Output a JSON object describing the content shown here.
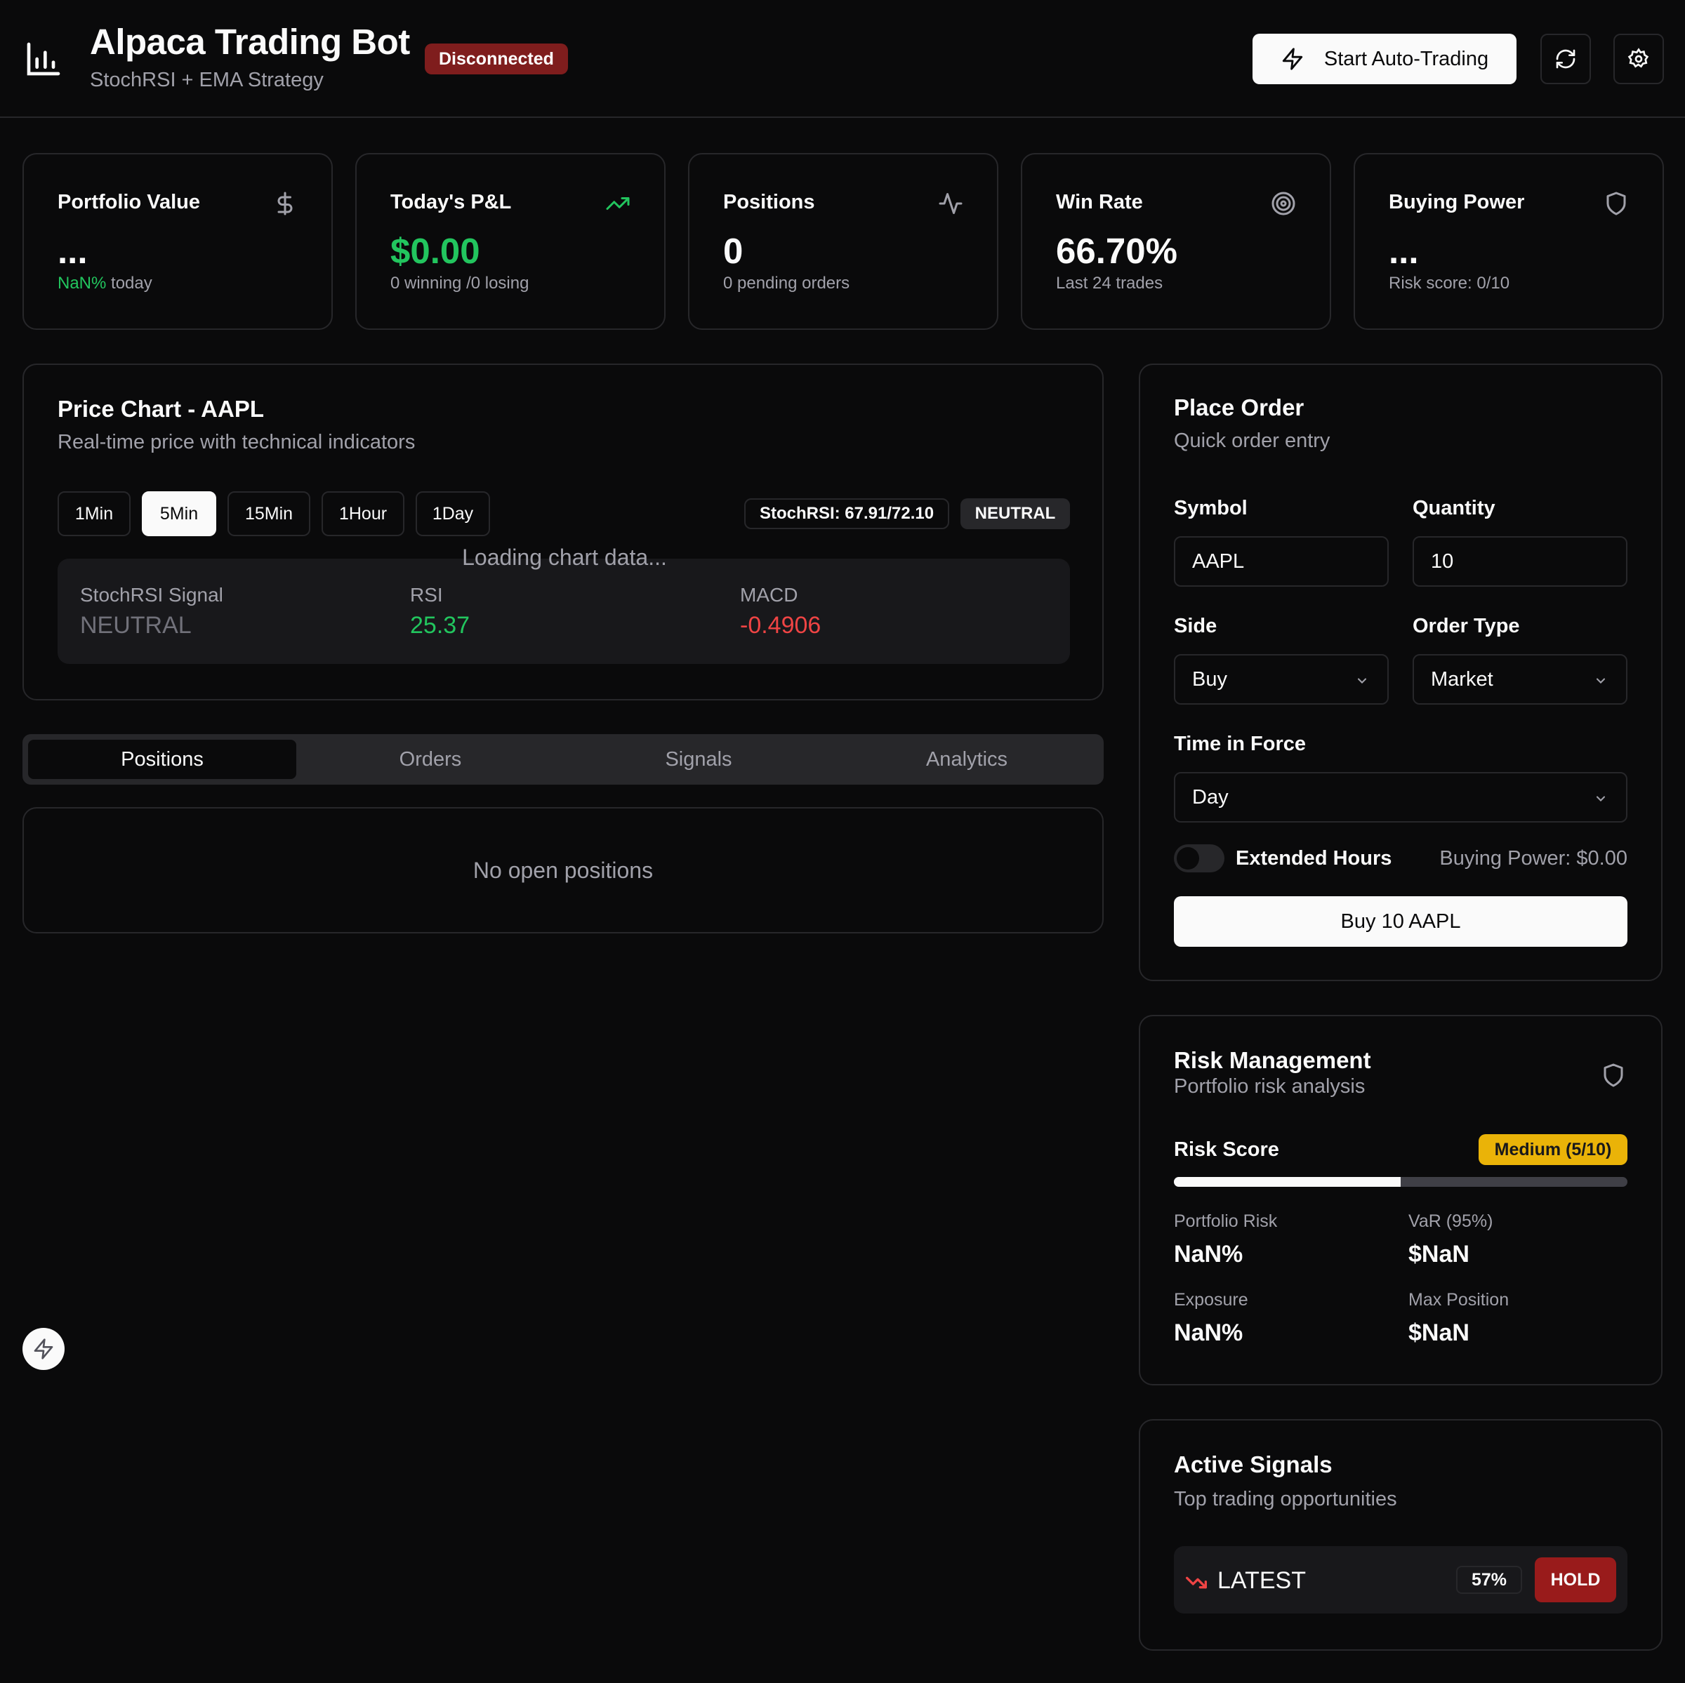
{
  "header": {
    "title": "Alpaca Trading Bot",
    "subtitle": "StochRSI + EMA Strategy",
    "status": "Disconnected",
    "auto_trading_label": "Start Auto-Trading"
  },
  "stats": [
    {
      "title": "Portfolio Value",
      "icon": "dollar-icon",
      "value": "...",
      "sub_highlight": "NaN%",
      "sub": " today"
    },
    {
      "title": "Today's P&L",
      "icon": "trending-up-icon",
      "value": "$0.00",
      "sub": "0 winning /0 losing"
    },
    {
      "title": "Positions",
      "icon": "activity-icon",
      "value": "0",
      "sub": "0 pending orders"
    },
    {
      "title": "Win Rate",
      "icon": "target-icon",
      "value": "66.70%",
      "sub": "Last 24 trades"
    },
    {
      "title": "Buying Power",
      "icon": "shield-icon",
      "value": "...",
      "sub": "Risk score: 0/10"
    }
  ],
  "price_chart": {
    "title": "Price Chart - AAPL",
    "subtitle": "Real-time price with technical indicators",
    "timeframes": [
      "1Min",
      "5Min",
      "15Min",
      "1Hour",
      "1Day"
    ],
    "active_timeframe": "5Min",
    "stochrsi_pill": "StochRSI: 67.91/72.10",
    "signal_pill": "NEUTRAL",
    "loading": "Loading chart data...",
    "indicators": [
      {
        "label": "StochRSI Signal",
        "value": "NEUTRAL"
      },
      {
        "label": "RSI",
        "value": "25.37"
      },
      {
        "label": "MACD",
        "value": "-0.4906"
      }
    ]
  },
  "tabs": [
    "Positions",
    "Orders",
    "Signals",
    "Analytics"
  ],
  "active_tab": "Positions",
  "positions_empty": "No open positions",
  "order": {
    "title": "Place Order",
    "subtitle": "Quick order entry",
    "symbol_label": "Symbol",
    "symbol_value": "AAPL",
    "quantity_label": "Quantity",
    "quantity_value": "10",
    "side_label": "Side",
    "side_value": "Buy",
    "type_label": "Order Type",
    "type_value": "Market",
    "tif_label": "Time in Force",
    "tif_value": "Day",
    "extended_label": "Extended Hours",
    "extended_on": false,
    "buying_power": "Buying Power: $0.00",
    "submit_label": "Buy 10 AAPL"
  },
  "risk": {
    "title": "Risk Management",
    "subtitle": "Portfolio risk analysis",
    "score_label": "Risk Score",
    "score_badge": "Medium (5/10)",
    "score_fraction": 0.5,
    "metrics": [
      {
        "label": "Portfolio Risk",
        "value": "NaN%"
      },
      {
        "label": "VaR (95%)",
        "value": "$NaN"
      },
      {
        "label": "Exposure",
        "value": "NaN%"
      },
      {
        "label": "Max Position",
        "value": "$NaN"
      }
    ]
  },
  "signals": {
    "title": "Active Signals",
    "subtitle": "Top trading opportunities",
    "items": [
      {
        "symbol": "LATEST",
        "confidence": "57%",
        "action": "HOLD",
        "icon": "trending-down-icon"
      }
    ]
  },
  "colors": {
    "background": "#0a0a0b",
    "border": "#27272a",
    "positive": "#22c55e",
    "negative": "#ef4444",
    "warning": "#eab308",
    "danger_badge": "#7f1d1d"
  }
}
